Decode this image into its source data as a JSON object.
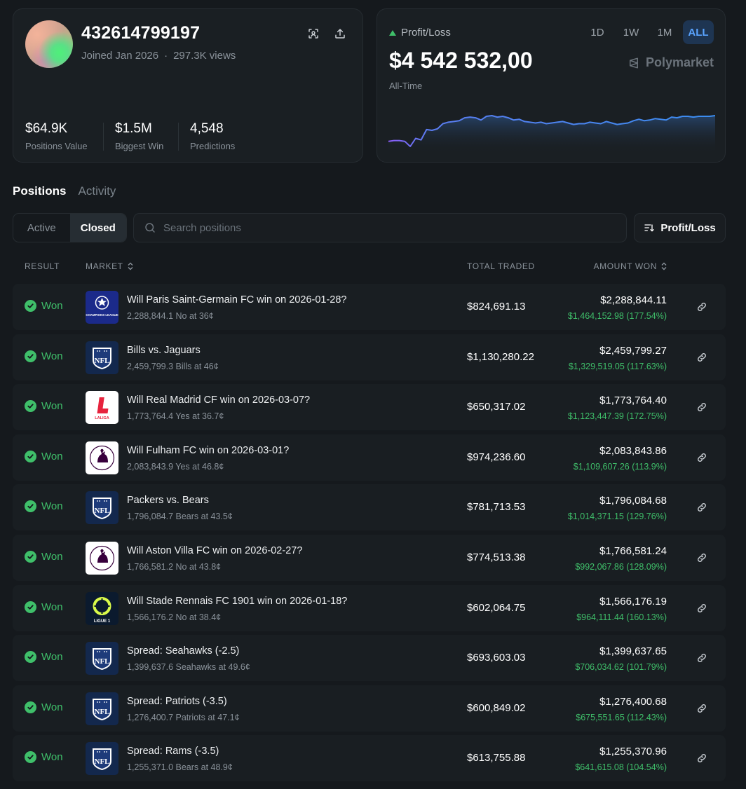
{
  "profile": {
    "username": "432614799197",
    "joined": "Joined Jan 2026",
    "separator": "·",
    "views": "297.3K views",
    "stats": [
      {
        "value": "$64.9K",
        "label": "Positions Value"
      },
      {
        "value": "$1.5M",
        "label": "Biggest Win"
      },
      {
        "value": "4,548",
        "label": "Predictions"
      }
    ]
  },
  "pnl": {
    "label": "Profit/Loss",
    "amount": "$4 542 532,00",
    "period": "All-Time",
    "brand": "Polymarket",
    "ranges": [
      "1D",
      "1W",
      "1M",
      "ALL"
    ],
    "active_range": "ALL",
    "chart_data": {
      "type": "area",
      "x": [
        0,
        1,
        2,
        3,
        4,
        5,
        6,
        7,
        8,
        9,
        10,
        11,
        12,
        13,
        14,
        15,
        16,
        17,
        18,
        19,
        20,
        21,
        22,
        23,
        24,
        25,
        26,
        27,
        28,
        29,
        30,
        31,
        32,
        33,
        34,
        35,
        36,
        37,
        38,
        39,
        40,
        41,
        42,
        43,
        44,
        45,
        46,
        47,
        48,
        49,
        50,
        51,
        52,
        53,
        54,
        55,
        56,
        57,
        58,
        59,
        60
      ],
      "y": [
        10,
        11,
        11,
        10,
        3,
        14,
        12,
        26,
        25,
        27,
        34,
        36,
        37,
        38,
        42,
        43,
        42,
        39,
        44,
        45,
        43,
        44,
        42,
        39,
        40,
        37,
        36,
        35,
        36,
        34,
        35,
        36,
        37,
        35,
        33,
        34,
        34,
        36,
        35,
        34,
        37,
        35,
        33,
        34,
        35,
        38,
        40,
        38,
        39,
        41,
        40,
        39,
        43,
        42,
        44,
        44,
        43,
        44,
        44,
        44,
        45
      ],
      "colors": {
        "start": "#8a5cf6",
        "end": "#3b8df0"
      }
    }
  },
  "tabs": {
    "main": [
      "Positions",
      "Activity"
    ],
    "active": "Positions",
    "segments": [
      "Active",
      "Closed"
    ],
    "active_segment": "Closed"
  },
  "search": {
    "placeholder": "Search positions"
  },
  "sort": {
    "label": "Profit/Loss"
  },
  "table": {
    "headers": {
      "result": "RESULT",
      "market": "MARKET",
      "traded": "TOTAL TRADED",
      "won": "AMOUNT WON"
    },
    "rows": [
      {
        "result": "Won",
        "logo": "champions-league",
        "title": "Will Paris Saint-Germain FC win on 2026-01-28?",
        "sub": "2,288,844.1 No at 36¢",
        "traded": "$824,691.13",
        "won": "$2,288,844.11",
        "gain": "$1,464,152.98 (177.54%)"
      },
      {
        "result": "Won",
        "logo": "nfl",
        "title": "Bills vs. Jaguars",
        "sub": "2,459,799.3 Bills at 46¢",
        "traded": "$1,130,280.22",
        "won": "$2,459,799.27",
        "gain": "$1,329,519.05 (117.63%)"
      },
      {
        "result": "Won",
        "logo": "laliga",
        "title": "Will Real Madrid CF win on 2026-03-07?",
        "sub": "1,773,764.4 Yes at 36.7¢",
        "traded": "$650,317.02",
        "won": "$1,773,764.40",
        "gain": "$1,123,447.39 (172.75%)"
      },
      {
        "result": "Won",
        "logo": "premier-league",
        "title": "Will Fulham FC win on 2026-03-01?",
        "sub": "2,083,843.9 Yes at 46.8¢",
        "traded": "$974,236.60",
        "won": "$2,083,843.86",
        "gain": "$1,109,607.26 (113.9%)"
      },
      {
        "result": "Won",
        "logo": "nfl",
        "title": "Packers vs. Bears",
        "sub": "1,796,084.7 Bears at 43.5¢",
        "traded": "$781,713.53",
        "won": "$1,796,084.68",
        "gain": "$1,014,371.15 (129.76%)"
      },
      {
        "result": "Won",
        "logo": "premier-league",
        "title": "Will Aston Villa FC win on 2026-02-27?",
        "sub": "1,766,581.2 No at 43.8¢",
        "traded": "$774,513.38",
        "won": "$1,766,581.24",
        "gain": "$992,067.86 (128.09%)"
      },
      {
        "result": "Won",
        "logo": "ligue-1",
        "title": "Will Stade Rennais FC 1901 win on 2026-01-18?",
        "sub": "1,566,176.2 No at 38.4¢",
        "traded": "$602,064.75",
        "won": "$1,566,176.19",
        "gain": "$964,111.44 (160.13%)"
      },
      {
        "result": "Won",
        "logo": "nfl",
        "title": "Spread: Seahawks (-2.5)",
        "sub": "1,399,637.6 Seahawks at 49.6¢",
        "traded": "$693,603.03",
        "won": "$1,399,637.65",
        "gain": "$706,034.62 (101.79%)"
      },
      {
        "result": "Won",
        "logo": "nfl",
        "title": "Spread: Patriots (-3.5)",
        "sub": "1,276,400.7 Patriots at 47.1¢",
        "traded": "$600,849.02",
        "won": "$1,276,400.68",
        "gain": "$675,551.65 (112.43%)"
      },
      {
        "result": "Won",
        "logo": "nfl",
        "title": "Spread: Rams (-3.5)",
        "sub": "1,255,371.0 Bears at 48.9¢",
        "traded": "$613,755.88",
        "won": "$1,255,370.96",
        "gain": "$641,615.08 (104.54%)"
      }
    ]
  },
  "logo_text": {
    "champions-league": "CHAMPIONS LEAGUE",
    "nfl": "NFL",
    "laliga": "LALIGA",
    "ligue-1": "LIGUE 1"
  },
  "colors": {
    "accent": "#5aa4ff",
    "positive": "#3fbf6a",
    "background": "#15191d"
  }
}
